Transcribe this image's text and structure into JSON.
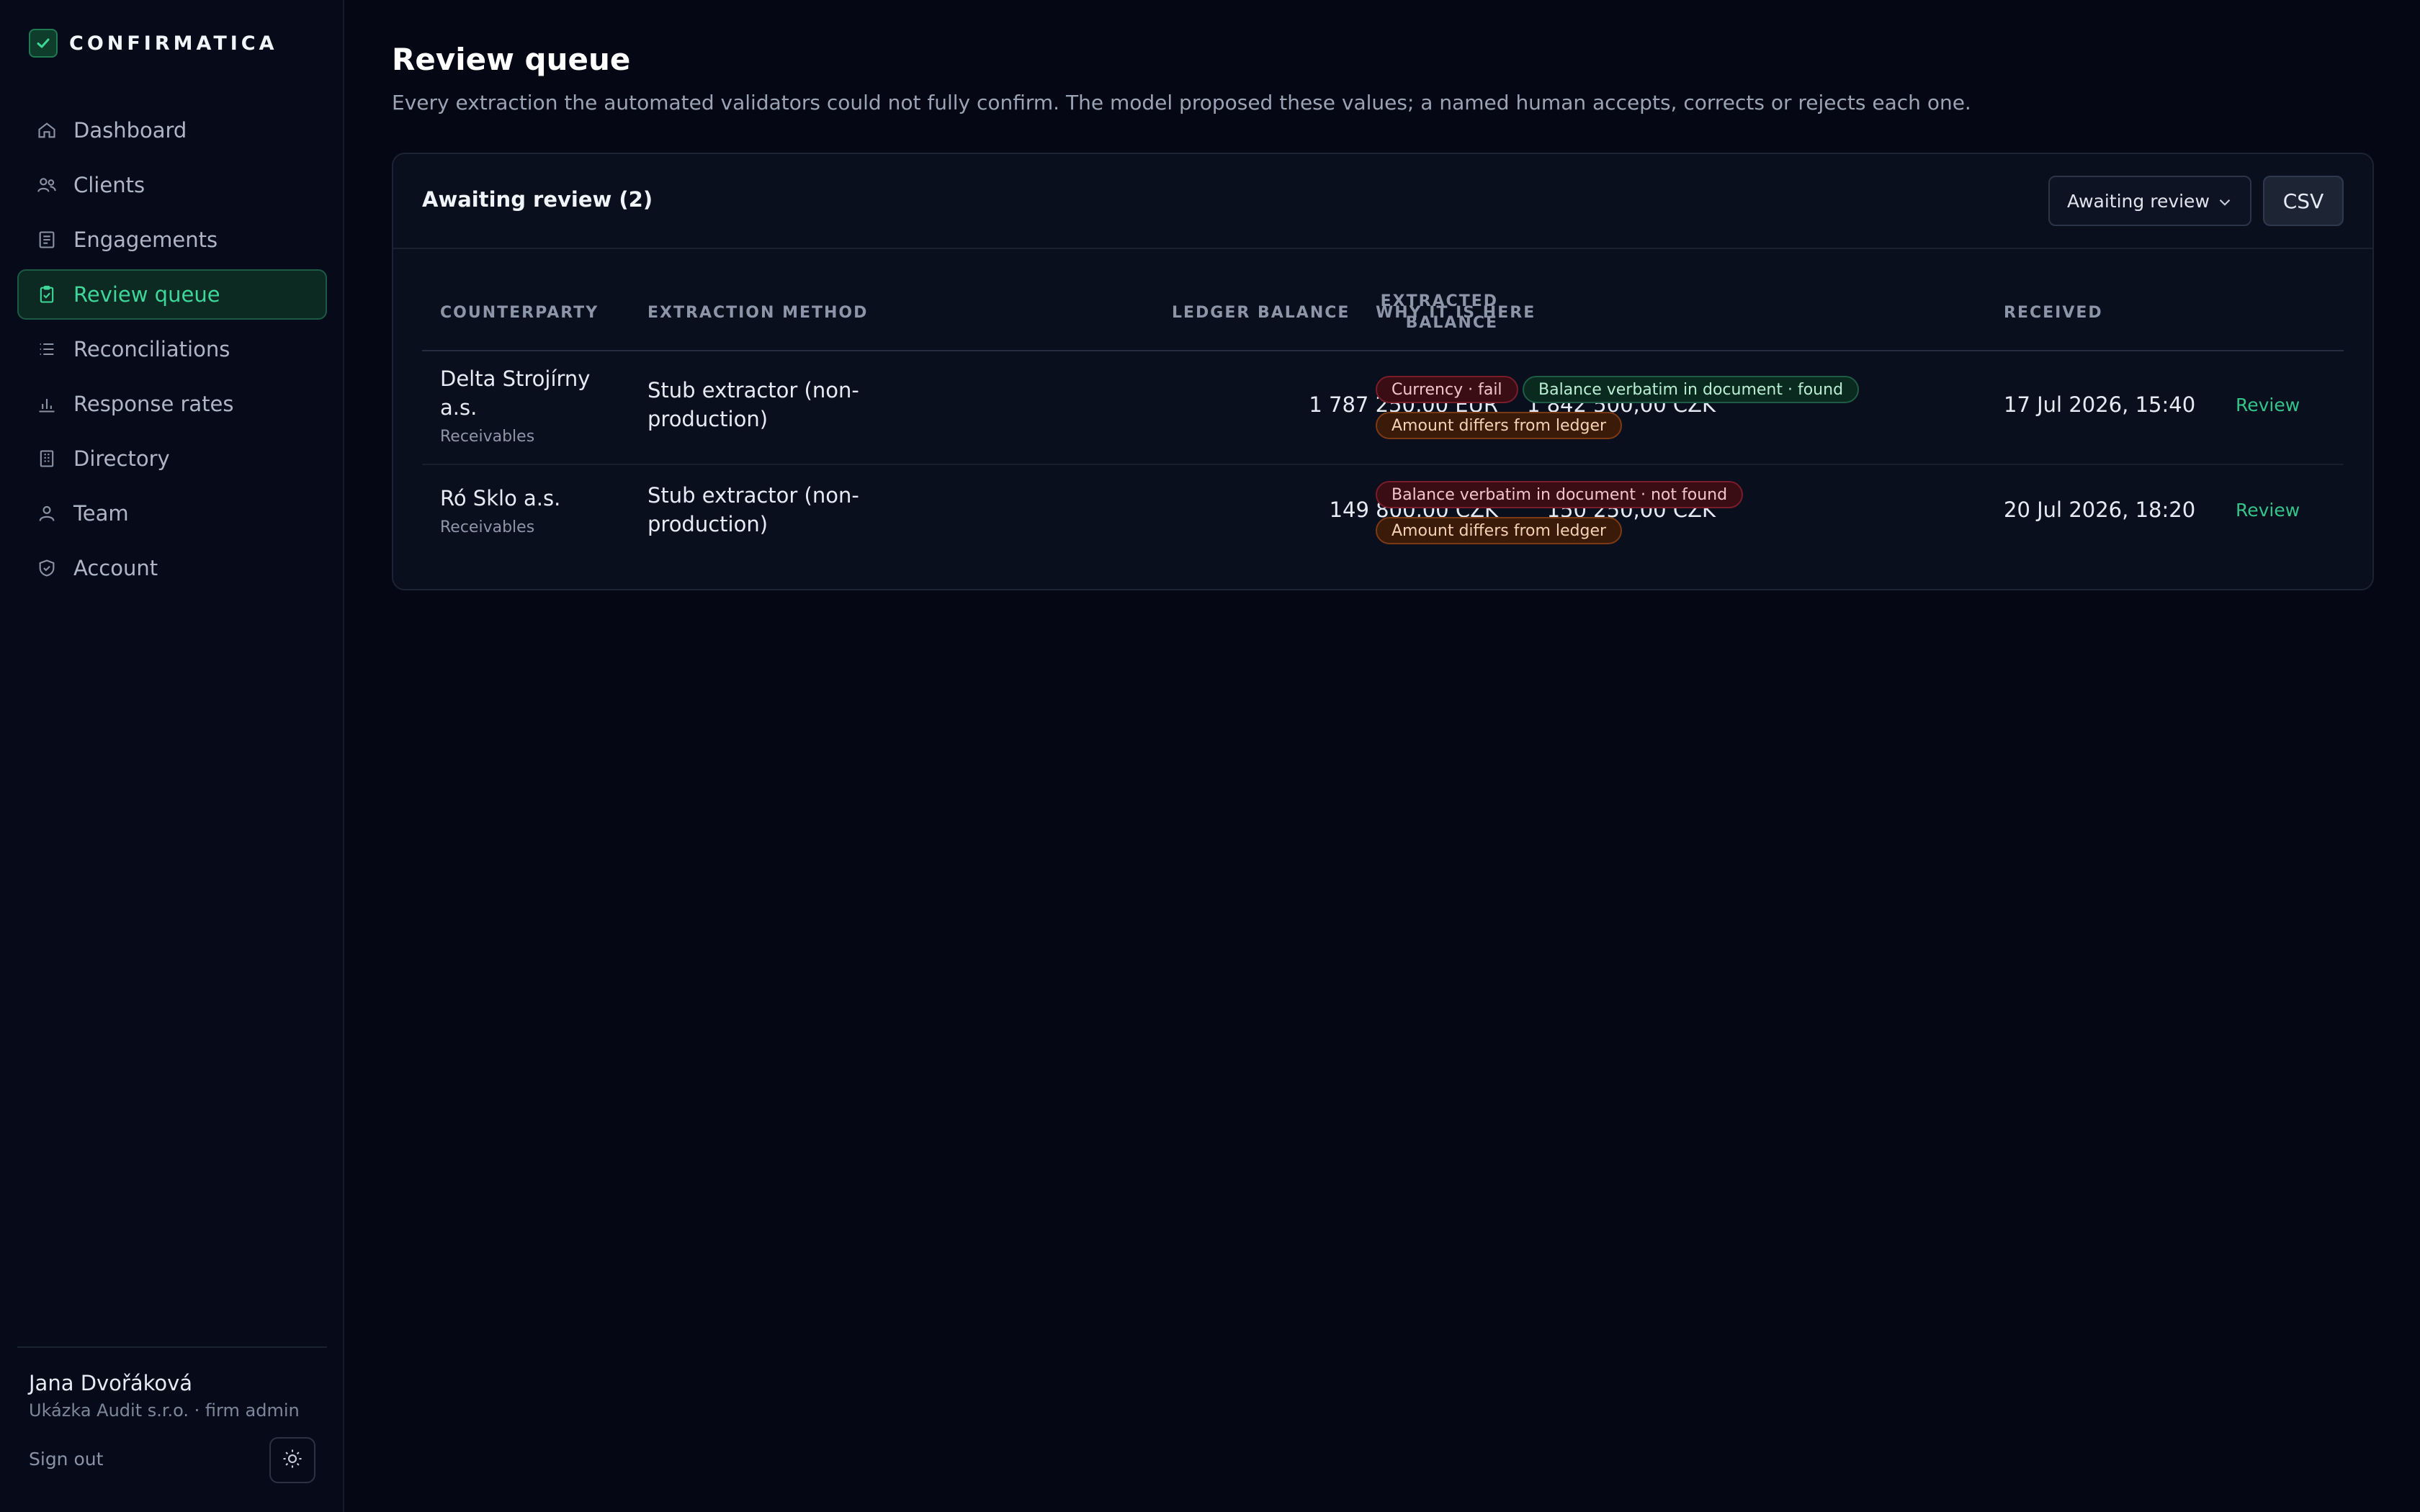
{
  "app": {
    "name": "CONFIRMATICA"
  },
  "sidebar": {
    "items": [
      {
        "label": "Dashboard",
        "icon": "home-icon",
        "active": false
      },
      {
        "label": "Clients",
        "icon": "users-icon",
        "active": false
      },
      {
        "label": "Engagements",
        "icon": "document-icon",
        "active": false
      },
      {
        "label": "Review queue",
        "icon": "clipboard-check-icon",
        "active": true
      },
      {
        "label": "Reconciliations",
        "icon": "list-icon",
        "active": false
      },
      {
        "label": "Response rates",
        "icon": "bar-chart-icon",
        "active": false
      },
      {
        "label": "Directory",
        "icon": "building-icon",
        "active": false
      },
      {
        "label": "Team",
        "icon": "person-icon",
        "active": false
      },
      {
        "label": "Account",
        "icon": "shield-icon",
        "active": false
      }
    ],
    "user": {
      "name": "Jana Dvořáková",
      "org": "Ukázka Audit s.r.o. · firm admin"
    },
    "sign_out": "Sign out"
  },
  "page": {
    "title": "Review queue",
    "subtitle": "Every extraction the automated validators could not fully confirm. The model proposed these values; a named human accepts, corrects or rejects each one."
  },
  "card": {
    "title": "Awaiting review (2)",
    "filter_value": "Awaiting review",
    "csv_label": "CSV"
  },
  "table": {
    "headers": {
      "counterparty": "COUNTERPARTY",
      "method": "EXTRACTION METHOD",
      "extracted_l1": "EXTRACTED",
      "extracted_l2": "BALANCE",
      "ledger": "LEDGER BALANCE",
      "why": "WHY IT IS HERE",
      "received": "RECEIVED"
    },
    "rows": [
      {
        "counterparty_l1": "Delta Strojírny",
        "counterparty_l2": "a.s.",
        "category": "Receivables",
        "method_l1": "Stub extractor (non-",
        "method_l2": "production)",
        "extracted": "1 787 250,00 EUR",
        "ledger": "1 842 500,00 CZK",
        "tags": [
          {
            "text": "Currency · fail",
            "tone": "red"
          },
          {
            "text": "Balance verbatim in document · found",
            "tone": "green"
          },
          {
            "text": "Amount differs from ledger",
            "tone": "orange"
          }
        ],
        "received": "17 Jul 2026, 15:40",
        "action": "Review"
      },
      {
        "counterparty_l1": "Ró Sklo a.s.",
        "category": "Receivables",
        "method_l1": "Stub extractor (non-",
        "method_l2": "production)",
        "extracted": "149 800,00 CZK",
        "ledger": "150 250,00 CZK",
        "tags": [
          {
            "text": "Balance verbatim in document · not found",
            "tone": "red"
          },
          {
            "text": "Amount differs from ledger",
            "tone": "orange"
          }
        ],
        "received": "20 Jul 2026, 18:20",
        "action": "Review"
      }
    ]
  },
  "colors": {
    "accent": "#3fd69a",
    "background": "#050814",
    "tag_red": "#7a1d2a",
    "tag_green": "#1e5c45",
    "tag_orange": "#7c3a14"
  }
}
